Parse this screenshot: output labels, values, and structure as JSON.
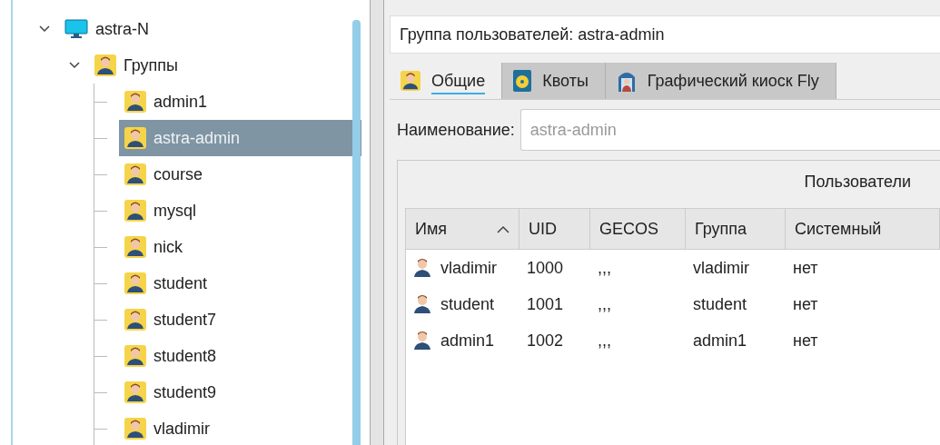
{
  "tree": [
    {
      "label": "astra-N",
      "kind": "computer",
      "expanded": true,
      "selected": false,
      "children": [
        {
          "label": "Группы",
          "kind": "group",
          "expanded": true,
          "selected": false,
          "children": [
            {
              "label": "admin1",
              "kind": "group",
              "selected": false
            },
            {
              "label": "astra-admin",
              "kind": "group",
              "selected": true
            },
            {
              "label": "course",
              "kind": "group",
              "selected": false
            },
            {
              "label": "mysql",
              "kind": "group",
              "selected": false
            },
            {
              "label": "nick",
              "kind": "group",
              "selected": false
            },
            {
              "label": "student",
              "kind": "group",
              "selected": false
            },
            {
              "label": "student7",
              "kind": "group",
              "selected": false
            },
            {
              "label": "student8",
              "kind": "group",
              "selected": false
            },
            {
              "label": "student9",
              "kind": "group",
              "selected": false
            },
            {
              "label": "vladimir",
              "kind": "group",
              "selected": false
            }
          ]
        }
      ]
    }
  ],
  "header": {
    "title": "Группа пользователей: astra-admin"
  },
  "tabs": [
    {
      "label": "Общие",
      "kind": "general",
      "selected": true
    },
    {
      "label": "Квоты",
      "kind": "quota",
      "selected": false
    },
    {
      "label": "Графический киоск Fly",
      "kind": "kiosk",
      "selected": false
    }
  ],
  "name_field": {
    "label": "Наименование:",
    "value": "astra-admin",
    "disabled": true
  },
  "users_group": {
    "title": "Пользователи",
    "columns": [
      {
        "label": "Имя",
        "sorted": true
      },
      {
        "label": "UID",
        "sorted": false
      },
      {
        "label": "GECOS",
        "sorted": false
      },
      {
        "label": "Группа",
        "sorted": false
      },
      {
        "label": "Системный",
        "sorted": false
      }
    ],
    "rows": [
      [
        "vladimir",
        "1000",
        ",,,",
        "vladimir",
        "нет"
      ],
      [
        "student",
        "1001",
        ",,,",
        "student",
        "нет"
      ],
      [
        "admin1",
        "1002",
        ",,,",
        "admin1",
        "нет"
      ]
    ]
  }
}
